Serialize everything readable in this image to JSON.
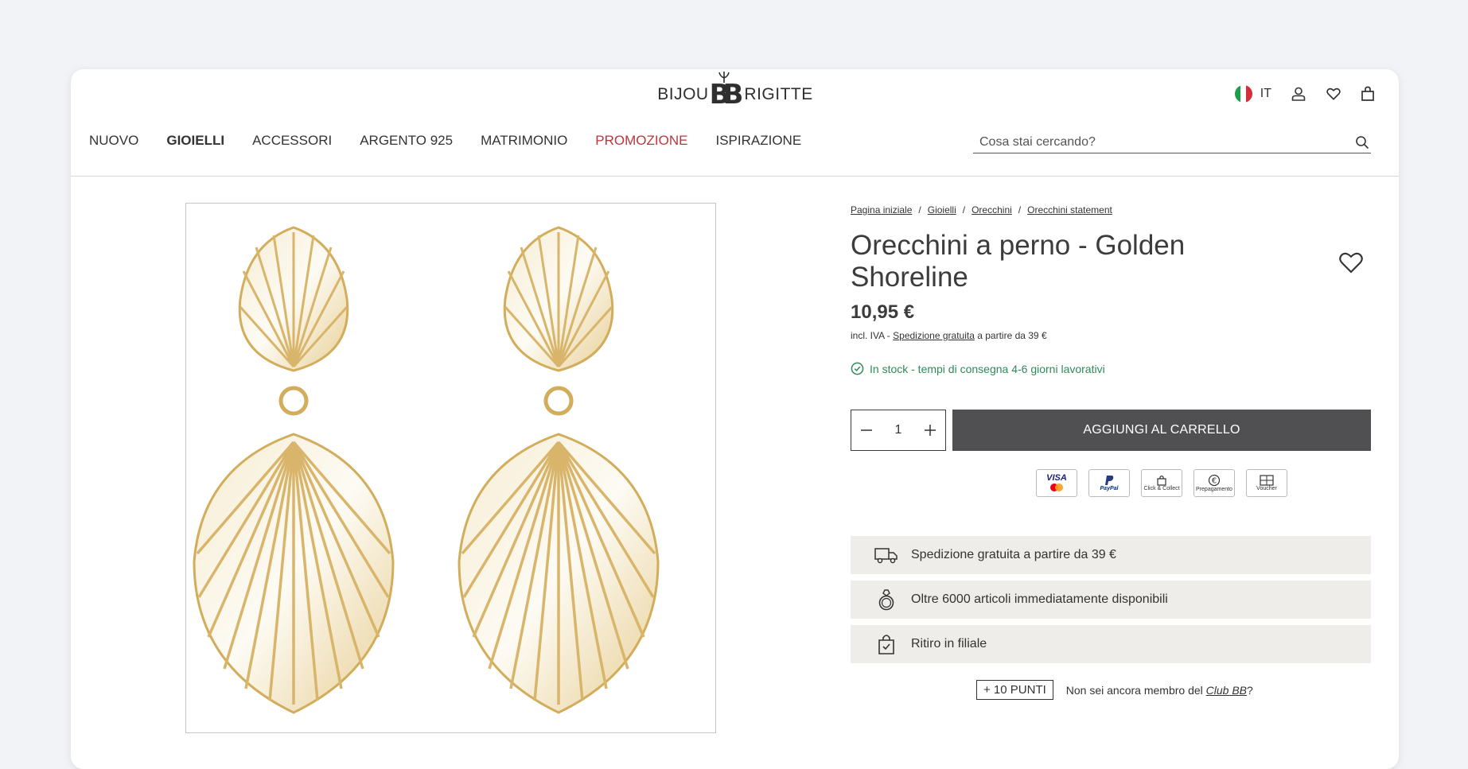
{
  "brand": {
    "left": "BIJOU",
    "mono": "BB",
    "right": "RIGITTE"
  },
  "header": {
    "language": "IT",
    "icons": [
      "flag-italy-icon",
      "user-icon",
      "heart-icon",
      "bag-icon"
    ],
    "nav": [
      "NUOVO",
      "GIOIELLI",
      "ACCESSORI",
      "ARGENTO 925",
      "MATRIMONIO",
      "PROMOZIONE",
      "ISPIRAZIONE"
    ],
    "search_placeholder": "Cosa stai cercando?"
  },
  "breadcrumbs": [
    "Pagina iniziale",
    "Gioielli",
    "Orecchini",
    "Orecchini statement"
  ],
  "breadcrumb_sep": "/",
  "product": {
    "title": "Orecchini a perno - Golden Shoreline",
    "price": "10,95 €",
    "tax_prefix": "incl. IVA - ",
    "tax_link": "Spedizione gratuita",
    "tax_suffix": " a partire da 39 €",
    "stock": "In stock - tempi di consegna 4-6 giorni lavorativi",
    "quantity": "1",
    "add_to_cart": "AGGIUNGI AL CARRELLO"
  },
  "payments": [
    {
      "name": "visa-mastercard",
      "label": "VISA"
    },
    {
      "name": "paypal",
      "label": "PayPal"
    },
    {
      "name": "click-collect",
      "label": "Click & Collect"
    },
    {
      "name": "prepayment",
      "label": "Prepagamento"
    },
    {
      "name": "voucher",
      "label": "Voucher"
    }
  ],
  "features": [
    {
      "icon": "free-shipping-truck-icon",
      "text": "Spedizione gratuita a partire da 39 €"
    },
    {
      "icon": "ring-icon",
      "text": "Oltre 6000 articoli immediatamente disponibili"
    },
    {
      "icon": "shopping-bag-check-icon",
      "text": "Ritiro in filiale"
    }
  ],
  "loyalty": {
    "points": "+ 10 PUNTI",
    "text": "Non sei ancora membro del ",
    "club": "Club BB",
    "end": "?"
  },
  "colors": {
    "promo": "#b8373e",
    "stock": "#2e8b57",
    "cart_button": "#505052",
    "feature_bg": "#eeede9",
    "gold": "#d8b56a"
  }
}
